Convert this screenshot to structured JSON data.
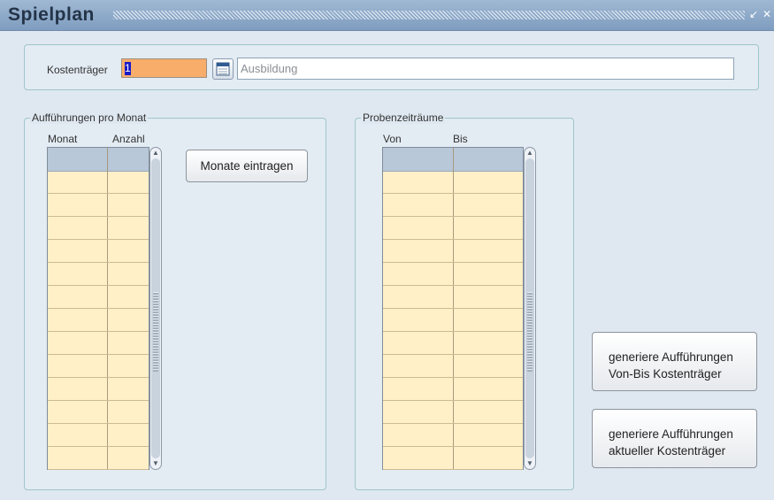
{
  "window": {
    "title": "Spielplan",
    "minimize_glyph": "↙",
    "close_glyph": "✕"
  },
  "header": {
    "kostentraeger_label": "Kostenträger",
    "kostentraeger_value": "1",
    "kostentraeger_name": "Ausbildung",
    "calendar_icon": "calendar-icon"
  },
  "auffuehrungen": {
    "legend": "Aufführungen pro Monat",
    "col_monat": "Monat",
    "col_anzahl": "Anzahl",
    "rows": 13,
    "button_label": "Monate eintragen"
  },
  "proben": {
    "legend": "Probenzeiträume",
    "col_von": "Von",
    "col_bis": "Bis",
    "rows": 13
  },
  "actions": {
    "generate_vonbis_line1": "generiere Aufführungen",
    "generate_vonbis_line2": "Von-Bis Kostenträger",
    "generate_current_line1": "generiere Aufführungen",
    "generate_current_line2": "aktueller Kostenträger"
  },
  "colors": {
    "field_required": "#f8ad6b",
    "grid_cell": "#fff0c8",
    "grid_header": "#b8c8d9",
    "titlebar": "#7f9dc0"
  }
}
